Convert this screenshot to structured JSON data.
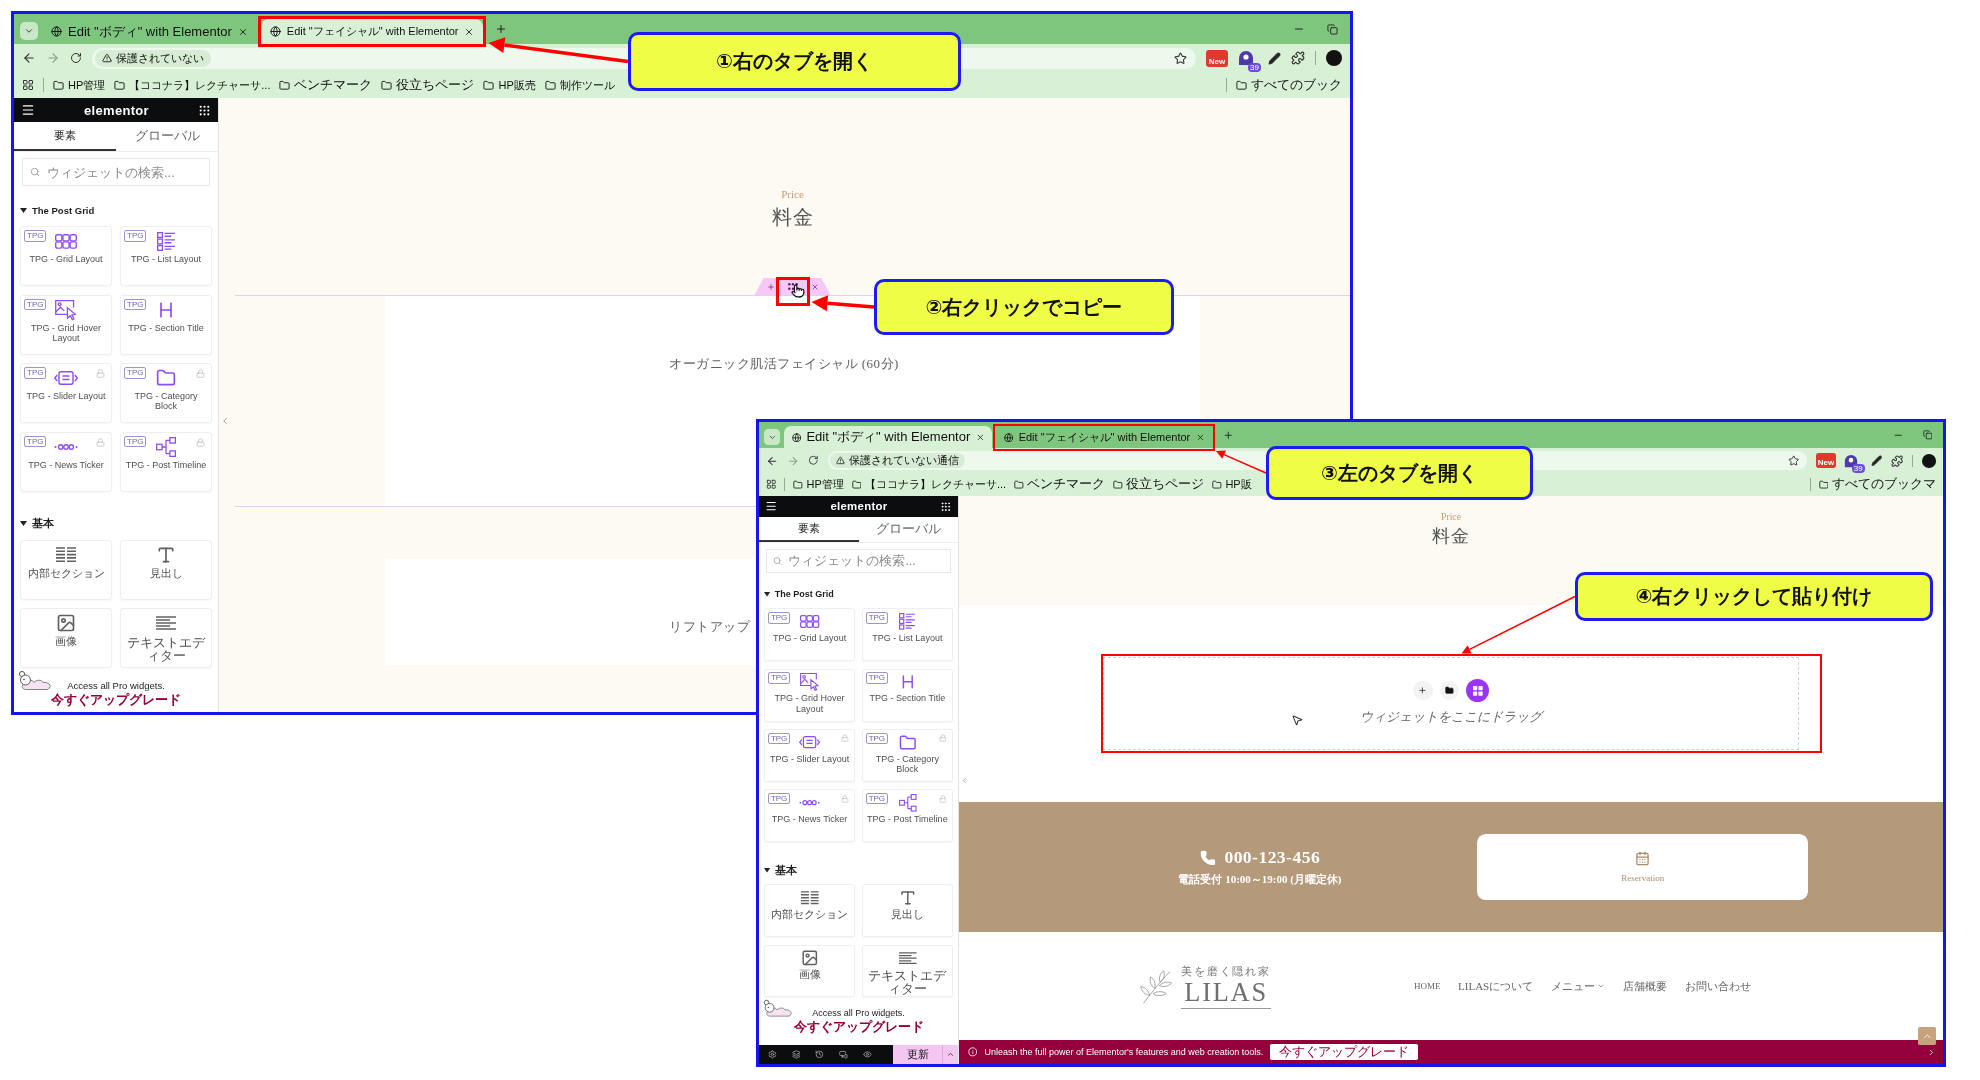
{
  "windows": [
    {
      "tabs": [
        {
          "title": "Edit \"ボディ\" with Elementor",
          "selected": false,
          "highlighted": false
        },
        {
          "title": "Edit \"フェイシャル\" with Elementor",
          "selected": true,
          "highlighted": true
        }
      ],
      "security": "保護されていない",
      "extensions": [
        {
          "kind": "tile",
          "label": "New"
        },
        {
          "kind": "badge",
          "label": "39"
        }
      ],
      "bookmarks": [
        "HP管理",
        "【ココナラ】レクチャーサ...",
        "ベンチマーク",
        "役立ちページ",
        "HP販売",
        "制作ツール"
      ],
      "all_bookmarks": "すべてのブック",
      "sidebar": {
        "brand": "elementor",
        "tabs": [
          {
            "label": "要素",
            "selected": true
          },
          {
            "label": "グローバル",
            "selected": false
          }
        ],
        "search_placeholder": "ウィジェットの検索...",
        "categories": [
          {
            "title": "The Post Grid",
            "expanded": true,
            "widgets": [
              {
                "kind": "grid",
                "tag": "TPG",
                "label": "TPG - Grid Layout",
                "locked": false
              },
              {
                "kind": "list",
                "tag": "TPG",
                "label": "TPG - List Layout",
                "locked": false
              },
              {
                "kind": "hover",
                "tag": "TPG",
                "label": "TPG - Grid Hover Layout",
                "locked": false
              },
              {
                "kind": "title",
                "tag": "TPG",
                "label": "TPG - Section Title",
                "locked": false
              },
              {
                "kind": "slider",
                "tag": "TPG",
                "label": "TPG - Slider Layout",
                "locked": true
              },
              {
                "kind": "category",
                "tag": "TPG",
                "label": "TPG - Category Block",
                "locked": true
              },
              {
                "kind": "ticker",
                "tag": "TPG",
                "label": "TPG - News Ticker",
                "locked": true
              },
              {
                "kind": "timeline",
                "tag": "TPG",
                "label": "TPG - Post Timeline",
                "locked": true
              }
            ]
          },
          {
            "title": "基本",
            "expanded": true,
            "widgets": [
              {
                "kind": "section",
                "label": "内部セクション",
                "locked": false
              },
              {
                "kind": "heading",
                "label": "見出し",
                "locked": false
              },
              {
                "kind": "image",
                "label": "画像",
                "locked": false
              },
              {
                "kind": "text",
                "label": "テキストエディター",
                "locked": false
              }
            ]
          }
        ],
        "promo": {
          "text": "Access all Pro widgets.",
          "link": "今すぐアップグレード"
        }
      },
      "page": [
        {
          "kind": "heading",
          "eyebrow": "Price",
          "title": "料金"
        },
        {
          "kind": "service",
          "title": "オーガニック肌活フェイシャル (60分)",
          "selected": true,
          "handle_highlighted": true
        },
        {
          "kind": "service",
          "title": "リフトアップ",
          "selected": false
        }
      ]
    },
    {
      "tabs": [
        {
          "title": "Edit \"ボディ\" with Elementor",
          "selected": true,
          "highlighted": false
        },
        {
          "title": "Edit \"フェイシャル\" with Elementor",
          "selected": false,
          "highlighted": true
        }
      ],
      "security": "保護されていない通信",
      "extensions": [
        {
          "kind": "tile",
          "label": "New"
        },
        {
          "kind": "badge",
          "label": "39"
        }
      ],
      "bookmarks": [
        "HP管理",
        "【ココナラ】レクチャーサ...",
        "ベンチマーク",
        "役立ちページ",
        "HP販"
      ],
      "all_bookmarks": "すべてのブックマ",
      "sidebar": {
        "brand": "elementor",
        "tabs": [
          {
            "label": "要素",
            "selected": true
          },
          {
            "label": "グローバル",
            "selected": false
          }
        ],
        "search_placeholder": "ウィジェットの検索...",
        "categories": [
          {
            "title": "The Post Grid",
            "expanded": true,
            "widgets": [
              {
                "kind": "grid",
                "tag": "TPG",
                "label": "TPG - Grid Layout",
                "locked": false
              },
              {
                "kind": "list",
                "tag": "TPG",
                "label": "TPG - List Layout",
                "locked": false
              },
              {
                "kind": "hover",
                "tag": "TPG",
                "label": "TPG - Grid Hover Layout",
                "locked": false
              },
              {
                "kind": "title",
                "tag": "TPG",
                "label": "TPG - Section Title",
                "locked": false
              },
              {
                "kind": "slider",
                "tag": "TPG",
                "label": "TPG - Slider Layout",
                "locked": true
              },
              {
                "kind": "category",
                "tag": "TPG",
                "label": "TPG - Category Block",
                "locked": true
              },
              {
                "kind": "ticker",
                "tag": "TPG",
                "label": "TPG - News Ticker",
                "locked": true
              },
              {
                "kind": "timeline",
                "tag": "TPG",
                "label": "TPG - Post Timeline",
                "locked": true
              }
            ]
          },
          {
            "title": "基本",
            "expanded": true,
            "widgets": [
              {
                "kind": "section",
                "label": "内部セクション",
                "locked": false
              },
              {
                "kind": "heading",
                "label": "見出し",
                "locked": false
              },
              {
                "kind": "image",
                "label": "画像",
                "locked": false
              },
              {
                "kind": "text",
                "label": "テキストエディター",
                "locked": false
              }
            ]
          }
        ],
        "promo": {
          "text": "Access all Pro widgets.",
          "link": "今すぐアップグレード"
        },
        "toolbar": {
          "publish": "更新"
        }
      },
      "page": [
        {
          "kind": "heading",
          "eyebrow": "Price",
          "title": "料金"
        },
        {
          "kind": "drop_zone",
          "hint": "ウィジェットをここにドラッグ",
          "highlighted": true
        },
        {
          "kind": "contact",
          "phone": "000-123-456",
          "hours": "電話受付 10:00～19:00 (月曜定休)",
          "button": "Reservation"
        },
        {
          "kind": "footer",
          "tagline": "美を磨く隠れ家",
          "logo": "LILAS",
          "nav": [
            {
              "label": "HOME",
              "dropdown": false
            },
            {
              "label": "LILASについて",
              "dropdown": false
            },
            {
              "label": "メニュー",
              "dropdown": true
            },
            {
              "label": "店舗概要",
              "dropdown": false
            },
            {
              "label": "お問い合わせ",
              "dropdown": false
            }
          ]
        }
      ],
      "notice": {
        "text": "Unleash the full power of Elementor's features and web creation tools.",
        "button": "今すぐアップグレード"
      }
    }
  ],
  "callouts": [
    "①右のタブを開く",
    "②右クリックでコピー",
    "③左のタブを開く",
    "④右クリックして貼り付け"
  ]
}
